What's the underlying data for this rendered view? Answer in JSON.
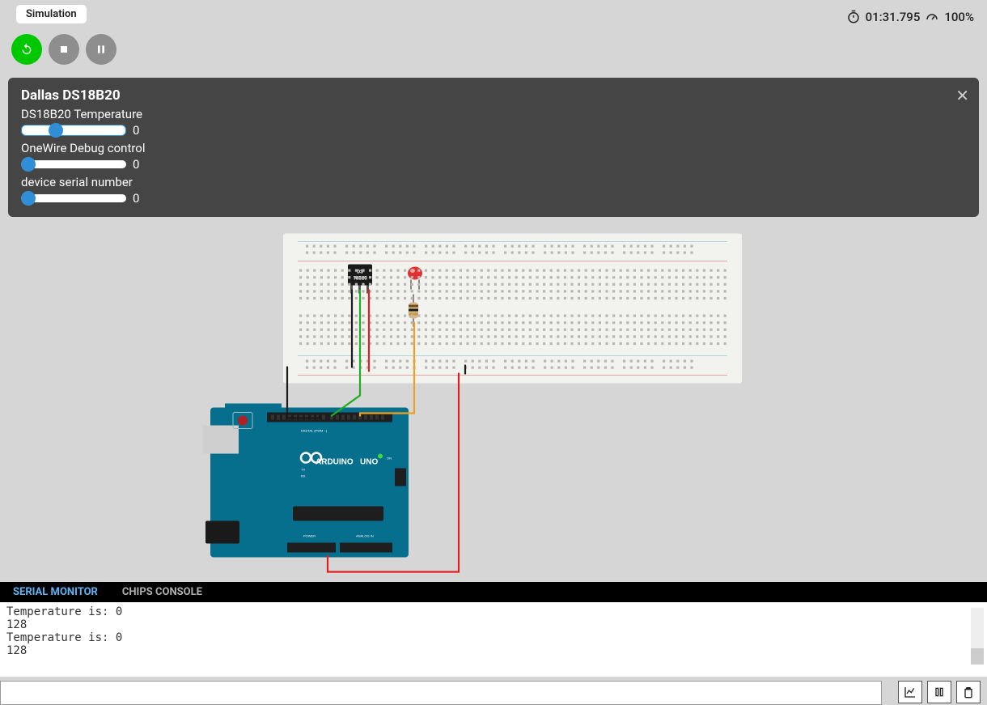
{
  "tab": {
    "label": "Simulation"
  },
  "controls": {
    "restart_icon": "restart",
    "stop_icon": "stop",
    "pause_icon": "pause"
  },
  "timer": {
    "elapsed": "01:31.795",
    "perf": "100%"
  },
  "panel": {
    "title": "Dallas DS18B20",
    "sliders": [
      {
        "label": "DS18B20 Temperature",
        "value": "0"
      },
      {
        "label": "OneWire Debug control",
        "value": "0"
      },
      {
        "label": "device serial number",
        "value": "0"
      }
    ]
  },
  "chip": {
    "line1": "DS",
    "line2": "18B20"
  },
  "arduino": {
    "brand": "ARDUINO",
    "model": "UNO",
    "tx": "TX",
    "rx": "RX",
    "on": "ON",
    "digital": "DIGITAL (PWM ~)",
    "power": "POWER",
    "analog": "ANALOG IN",
    "aref": "AREF",
    "gnd": "GND"
  },
  "tabs": {
    "serial": "SERIAL MONITOR",
    "chips": "CHIPS CONSOLE"
  },
  "serial": {
    "lines": [
      "Temperature is: 0",
      "128",
      "Temperature is: 0",
      "128"
    ]
  }
}
